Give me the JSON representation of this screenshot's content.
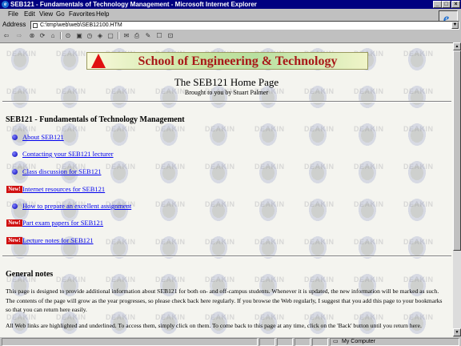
{
  "window": {
    "title": "SEB121 - Fundamentals of Technology Management - Microsoft Internet Explorer"
  },
  "menu": [
    "File",
    "Edit",
    "View",
    "Go",
    "Favorites",
    "Help"
  ],
  "address": {
    "label": "Address",
    "value": "C:\\tmp\\web\\web\\SEB12100.HTM"
  },
  "page": {
    "banner": "School of Engineering & Technology",
    "title": "The SEB121 Home Page",
    "subtitle": "Brought to you by Stuart Palmer",
    "section_heading": "SEB121 - Fundamentals of Technology Management",
    "new_label": "New!",
    "links": [
      {
        "label": "About SEB121",
        "marker": "bullet"
      },
      {
        "label": "Contacting your SEB121 lecturer",
        "marker": "bullet"
      },
      {
        "label": "Class discussion for SEB121",
        "marker": "bullet"
      },
      {
        "label": "Internet resources for SEB121",
        "marker": "new"
      },
      {
        "label": "How to prepare an excellent assignment",
        "marker": "bullet"
      },
      {
        "label": "Part exam papers for SEB121",
        "marker": "new"
      },
      {
        "label": "Lecture notes for SEB121",
        "marker": "new"
      }
    ],
    "watermark": "DEAKIN",
    "general_heading": "General notes",
    "para1": "This page is designed to provide additional information about SEB121 for both on- and off-campus students. Whenever it is updated, the new information will be marked as such. The contents of the page will grow as the year progresses, so please check back here regularly. If you browse the Web regularly, I suggest that you add this page to your bookmarks so that you can return here easily.",
    "para2": "All Web links are highlighted and underlined. To access them, simply click on them. To come back to this page at any time, click on the 'Back' button until you return here."
  },
  "status": {
    "zone": "My Computer"
  },
  "colors": {
    "titlebar": "#000080",
    "link": "#0000ee",
    "new_badge": "#d01010",
    "banner_text": "#a81818"
  }
}
